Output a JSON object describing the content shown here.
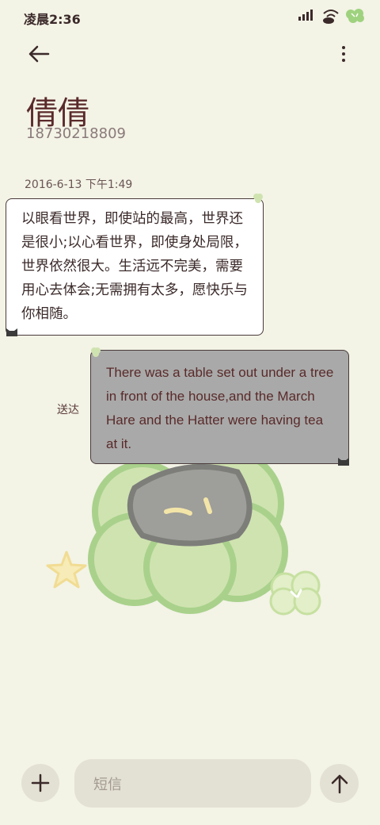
{
  "status_bar": {
    "time": "凌晨2:36"
  },
  "header": {
    "contact_name": "倩倩",
    "contact_number": "18730218809",
    "back_icon": "arrow-left-icon",
    "more_icon": "more-vertical-icon"
  },
  "conversation": {
    "timestamp": "2016-6-13 下午1:49",
    "messages": [
      {
        "direction": "received",
        "text": "以眼看世界，即使站的最高，世界还是很小;以心看世界，即使身处局限，世界依然很大。生活远不完美，需要用心去体会;无需拥有太多，愿快乐与你相随。"
      },
      {
        "direction": "sent",
        "text": "There was a table set out under a tree in front of the house,and the March Hare and the Hatter were having tea at it.",
        "status": "送达"
      }
    ]
  },
  "composer": {
    "placeholder": "短信",
    "add_icon": "plus-icon",
    "send_icon": "arrow-up-icon"
  },
  "colors": {
    "background": "#f3f3e6",
    "received_bubble": "#ffffff",
    "sent_bubble": "#a9a9a9",
    "control_bg": "#e3e1d3"
  }
}
